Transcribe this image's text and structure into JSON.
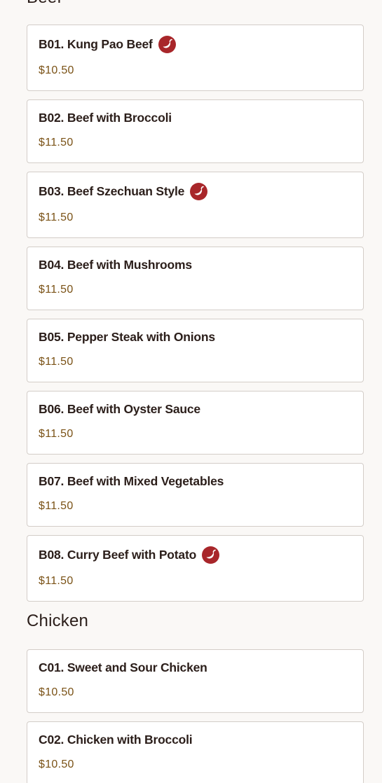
{
  "sections": [
    {
      "title": "Beef",
      "items": [
        {
          "name": "B01. Kung Pao Beef",
          "price": "$10.50",
          "spicy": true
        },
        {
          "name": "B02. Beef with Broccoli",
          "price": "$11.50",
          "spicy": false
        },
        {
          "name": "B03. Beef Szechuan Style",
          "price": "$11.50",
          "spicy": true
        },
        {
          "name": "B04. Beef with Mushrooms",
          "price": "$11.50",
          "spicy": false
        },
        {
          "name": "B05. Pepper Steak with Onions",
          "price": "$11.50",
          "spicy": false
        },
        {
          "name": "B06. Beef with Oyster Sauce",
          "price": "$11.50",
          "spicy": false
        },
        {
          "name": "B07. Beef with Mixed Vegetables",
          "price": "$11.50",
          "spicy": false
        },
        {
          "name": "B08. Curry Beef with Potato",
          "price": "$11.50",
          "spicy": true
        }
      ]
    },
    {
      "title": "Chicken",
      "items": [
        {
          "name": "C01. Sweet and Sour Chicken",
          "price": "$10.50",
          "spicy": false
        },
        {
          "name": "C02. Chicken with Broccoli",
          "price": "$10.50",
          "spicy": false
        }
      ]
    }
  ],
  "colors": {
    "spicy_icon": "#a8262a",
    "price": "#7a5216",
    "card_border": "#d3cdc8"
  },
  "icons": {
    "spicy": "chili-pepper-icon"
  }
}
